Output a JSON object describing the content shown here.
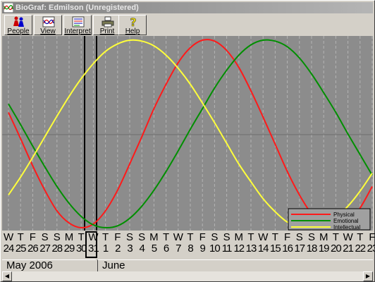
{
  "window": {
    "title": "BioGraf: Edmilson (Unregistered)"
  },
  "toolbar": {
    "buttons": [
      {
        "label": "People",
        "icon": "people-icon"
      },
      {
        "label": "View",
        "icon": "view-icon"
      },
      {
        "label": "Interpret",
        "icon": "interpret-icon"
      },
      {
        "label": "Print",
        "icon": "print-icon"
      },
      {
        "label": "Help",
        "icon": "help-icon"
      }
    ]
  },
  "legend": {
    "items": [
      {
        "label": "Physical",
        "color": "#ff1a1a"
      },
      {
        "label": "Emotional",
        "color": "#008f00"
      },
      {
        "label": "Intellectual",
        "color": "#ffff3b"
      }
    ]
  },
  "calendar": {
    "weekdays": [
      "W",
      "T",
      "F",
      "S",
      "S",
      "M",
      "T",
      "W",
      "T",
      "F",
      "S",
      "S",
      "M",
      "T",
      "W",
      "T",
      "F",
      "S",
      "S",
      "M",
      "T",
      "W",
      "T",
      "F",
      "S",
      "S",
      "M",
      "T",
      "W",
      "T",
      "F"
    ],
    "dates": [
      "24",
      "25",
      "26",
      "27",
      "28",
      "29",
      "30",
      "31",
      "1",
      "2",
      "3",
      "4",
      "5",
      "6",
      "7",
      "8",
      "9",
      "10",
      "11",
      "12",
      "13",
      "14",
      "15",
      "16",
      "17",
      "18",
      "19",
      "20",
      "21",
      "22",
      "23"
    ],
    "selected_date": "31",
    "months": [
      "May 2006",
      "June"
    ]
  },
  "chart_data": {
    "type": "line",
    "x": [
      "24",
      "25",
      "26",
      "27",
      "28",
      "29",
      "30",
      "31",
      "1",
      "2",
      "3",
      "4",
      "5",
      "6",
      "7",
      "8",
      "9",
      "10",
      "11",
      "12",
      "13",
      "14",
      "15",
      "16",
      "17",
      "18",
      "19",
      "20",
      "21",
      "22",
      "23"
    ],
    "ylim": [
      -1,
      1
    ],
    "grid": true,
    "legend_position": "bottom-right",
    "series": [
      {
        "name": "Physical",
        "color": "#ff1a1a",
        "values": [
          0.23,
          -0.05,
          -0.34,
          -0.6,
          -0.82,
          -0.95,
          -1.0,
          -0.96,
          -0.82,
          -0.6,
          -0.32,
          -0.03,
          0.27,
          0.53,
          0.76,
          0.92,
          1.0,
          0.99,
          0.89,
          0.71,
          0.46,
          0.18,
          -0.11,
          -0.4,
          -0.65,
          -0.85,
          -0.97,
          -1.0,
          -0.94,
          -0.79,
          -0.56
        ]
      },
      {
        "name": "Emotional",
        "color": "#008f00",
        "values": [
          0.32,
          0.1,
          -0.13,
          -0.35,
          -0.56,
          -0.74,
          -0.88,
          -0.97,
          -1.0,
          -0.98,
          -0.9,
          -0.77,
          -0.6,
          -0.4,
          -0.18,
          0.05,
          0.27,
          0.49,
          0.68,
          0.84,
          0.95,
          1.0,
          0.99,
          0.93,
          0.81,
          0.64,
          0.44,
          0.23,
          0.0,
          -0.22,
          -0.44
        ]
      },
      {
        "name": "Intellectual",
        "color": "#ffff3b",
        "values": [
          -0.65,
          -0.46,
          -0.25,
          -0.03,
          0.19,
          0.4,
          0.59,
          0.75,
          0.88,
          0.96,
          1.0,
          0.99,
          0.94,
          0.84,
          0.7,
          0.53,
          0.33,
          0.12,
          -0.1,
          -0.32,
          -0.51,
          -0.69,
          -0.83,
          -0.94,
          -0.99,
          -1.0,
          -0.97,
          -0.89,
          -0.77,
          -0.61,
          -0.42
        ]
      }
    ]
  }
}
